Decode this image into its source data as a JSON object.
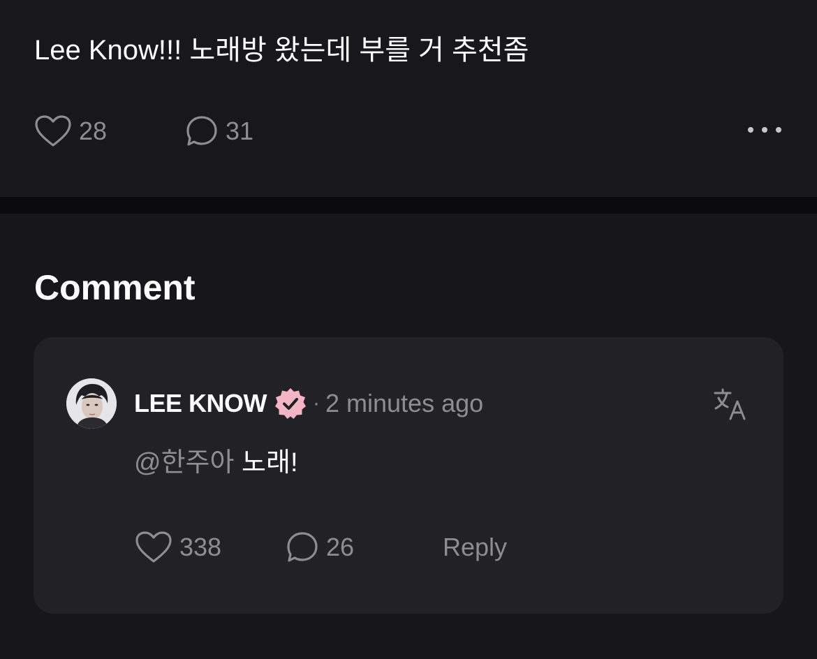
{
  "post": {
    "text": "Lee Know!!! 노래방 왔는데 부를 거 추천좀",
    "likes": "28",
    "comments": "31",
    "like_icon": "heart-icon",
    "comment_icon": "speech-bubble-icon",
    "more_icon": "more-horizontal-icon"
  },
  "comments_section": {
    "title": "Comment",
    "comment": {
      "author": "LEE KNOW",
      "separator": "·",
      "time": "2 minutes ago",
      "mention": "@한주아",
      "text": "노래!",
      "likes": "338",
      "replies": "26",
      "reply_label": "Reply",
      "verified_badge_color": "#f4b6c4",
      "translate_icon": "translate-icon"
    }
  },
  "colors": {
    "background": "#16161b",
    "card": "#212126",
    "divider": "#0b0b0e",
    "muted_text": "#8d8d93",
    "text": "#ffffff"
  }
}
